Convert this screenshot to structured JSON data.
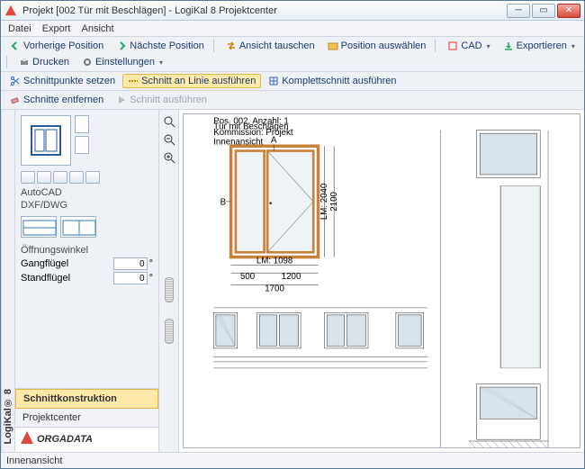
{
  "window": {
    "title": "Projekt [002 Tür mit Beschlägen] - LogiKal 8 Projektcenter"
  },
  "menubar": {
    "items": [
      "Datei",
      "Export",
      "Ansicht"
    ]
  },
  "toolbar1": {
    "prev": "Vorherige Position",
    "next": "Nächste Position",
    "swap": "Ansicht tauschen",
    "select": "Position auswählen",
    "cad": "CAD",
    "export": "Exportieren",
    "print": "Drucken",
    "settings": "Einstellungen"
  },
  "toolbar2": {
    "setpts": "Schnittpunkte setzen",
    "online": "Schnitt an Linie ausführen",
    "complete": "Komplettschnitt ausführen"
  },
  "toolbar3": {
    "remove": "Schnitte entfernen",
    "run": "Schnitt ausführen"
  },
  "sidebar": {
    "cad_label": "AutoCAD",
    "format_label": "DXF/DWG",
    "angle_header": "Öffnungswinkel",
    "gang_label": "Gangflügel",
    "stand_label": "Standflügel",
    "gang_value": "0",
    "stand_value": "0",
    "unit": "°",
    "tabs": {
      "schnitt": "Schnittkonstruktion",
      "projekt": "Projektcenter"
    },
    "brand": "ORGADATA",
    "vtab": "LogiKal® 8"
  },
  "drawing": {
    "header1": "Pos. 002, Anzahl: 1",
    "header2": "Tür mit Beschlägen",
    "header3": "Kommission: Projekt",
    "view": "Innenansicht",
    "dim_lm_h": "LM: 2040",
    "dim_h": "2100",
    "dim_lm_w": "LM: 1098",
    "dim_w1": "500",
    "dim_w2": "1200",
    "dim_w3": "1700",
    "mark_a": "A",
    "mark_b": "B"
  },
  "status": {
    "text": "Innenansicht"
  }
}
